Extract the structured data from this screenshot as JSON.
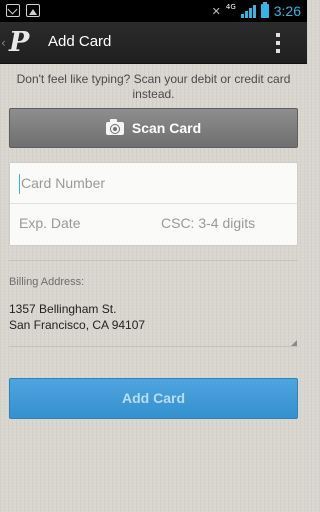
{
  "status_bar": {
    "notification_icons": [
      "mail-icon",
      "image-icon"
    ],
    "network_type": "4G",
    "time": "3:26",
    "accent_color": "#33b5e5"
  },
  "action_bar": {
    "title": "Add Card",
    "logo_text": "P",
    "overflow_icon": "overflow-menu-icon"
  },
  "scan": {
    "prompt": "Don't feel like typing? Scan your debit or credit card instead.",
    "button_label": "Scan Card",
    "button_icon": "camera-icon"
  },
  "card_form": {
    "card_number_placeholder": "Card Number",
    "exp_date_placeholder": "Exp. Date",
    "csc_placeholder": "CSC: 3-4 digits"
  },
  "billing": {
    "label": "Billing Address:",
    "address_line1": "1357 Bellingham St.",
    "address_line2": "San Francisco, CA 94107"
  },
  "submit": {
    "label": "Add Card",
    "color": "#3d99d6"
  }
}
